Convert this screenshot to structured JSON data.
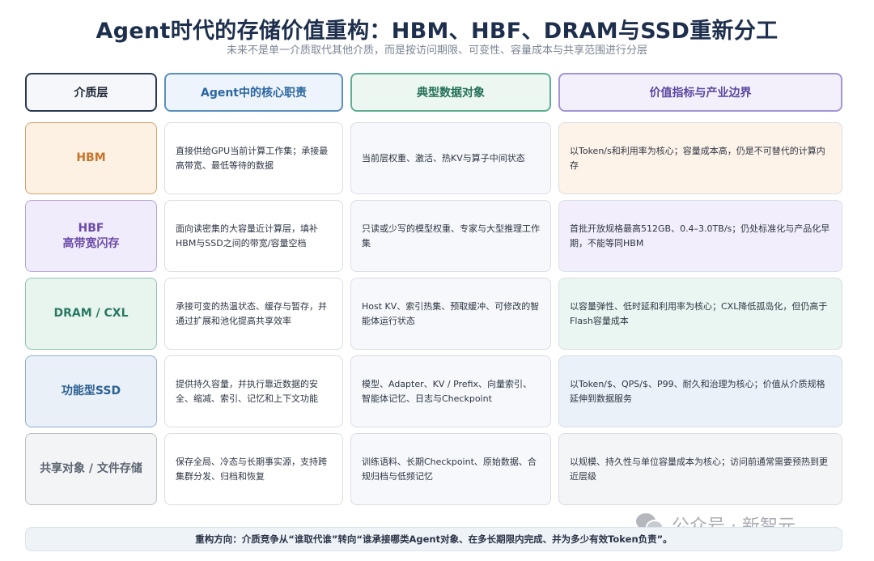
{
  "title": "Agent时代的存储价值重构：HBM、HBF、DRAM与SSD重新分工",
  "subtitle": "未来不是单一介质取代其他介质，而是按访问期限、可变性、容量成本与共享范围进行分层",
  "headers": [
    "介质层",
    "Agent中的核心职责",
    "典型数据对象",
    "价值指标与产业边界"
  ],
  "rows": [
    {
      "label": "HBM",
      "duty": "直接供给GPU当前计算工作集；承接最高带宽、最低等待的数据",
      "objects": "当前层权重、激活、热KV与算子中间状态",
      "value": "以Token/s和利用率为核心；容量成本高，仍是不可替代的计算内存"
    },
    {
      "label": "HBF\n高带宽闪存",
      "duty": "面向读密集的大容量近计算层，填补HBM与SSD之间的带宽/容量空档",
      "objects": "只读或少写的模型权重、专家与大型推理工作集",
      "value": "首批开放规格最高512GB、0.4–3.0TB/s；仍处标准化与产品化早期，不能等同HBM"
    },
    {
      "label": "DRAM / CXL",
      "duty": "承接可变的热温状态、缓存与暂存，并通过扩展和池化提高共享效率",
      "objects": "Host KV、索引热集、预取缓冲、可修改的智能体运行状态",
      "value": "以容量弹性、低时延和利用率为核心；CXL降低孤岛化，但仍高于Flash容量成本"
    },
    {
      "label": "功能型SSD",
      "duty": "提供持久容量，并执行靠近数据的安全、缩减、索引、记忆和上下文功能",
      "objects": "模型、Adapter、KV / Prefix、向量索引、智能体记忆、日志与Checkpoint",
      "value": "以Token/$、QPS/$、P99、耐久和治理为核心；价值从介质规格延伸到数据服务"
    },
    {
      "label": "共享对象 / 文件存储",
      "duty": "保存全局、冷态与长期事实源，支持跨集群分发、归档和恢复",
      "objects": "训练语料、长期Checkpoint、原始数据、合规归档与低频记忆",
      "value": "以规模、持久性与单位容量成本为核心；访问前通常需要预热到更近层级"
    }
  ],
  "footer": "重构方向：介质竞争从“谁取代谁”转向“谁承接哪类Agent对象、在多长期限内完成、并为多少有效Token负责”。",
  "watermark": "公众号 · 新智元",
  "colors": {
    "hbm": {
      "text": "#c8752a",
      "border": "#d9a06b",
      "bg": "#fdf1e4"
    },
    "hbf": {
      "text": "#6a4aa8",
      "border": "#b6a3dc",
      "bg": "#f1ecfb"
    },
    "dram": {
      "text": "#2a7a63",
      "border": "#8fc4b1",
      "bg": "#e8f5ef"
    },
    "ssd": {
      "text": "#2c5f93",
      "border": "#8fb0d4",
      "bg": "#e9f0f8"
    },
    "shared": {
      "text": "#5b6470",
      "border": "#b9bfc7",
      "bg": "#f3f4f6"
    }
  }
}
